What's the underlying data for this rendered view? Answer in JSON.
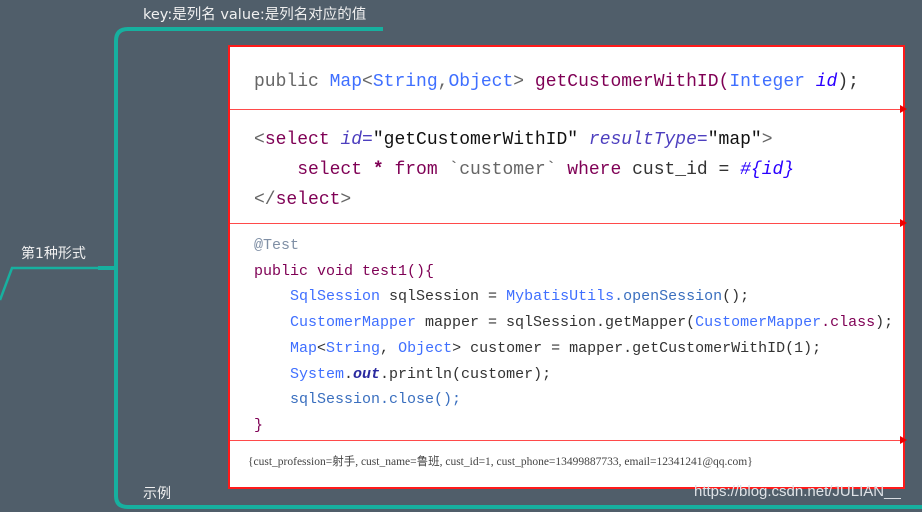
{
  "mindmap": {
    "top_label": "key:是列名  value:是列名对应的值",
    "branch_label": "第1种形式",
    "example_label": "示例",
    "line_color": "#17b09f"
  },
  "code": {
    "signature": [
      [
        {
          "t": "public ",
          "c": "g"
        },
        {
          "t": "Map",
          "c": "t"
        },
        {
          "t": "<",
          "c": "g"
        },
        {
          "t": "String",
          "c": "t"
        },
        {
          "t": ",",
          "c": "g"
        },
        {
          "t": "Object",
          "c": "t"
        },
        {
          "t": "> ",
          "c": "g"
        },
        {
          "t": "getCustomerWithID(",
          "c": "kw"
        },
        {
          "t": "Integer ",
          "c": "t"
        },
        {
          "t": "id",
          "c": "v"
        },
        {
          "t": ");",
          "c": "p"
        }
      ]
    ],
    "xml": [
      [
        {
          "t": "<",
          "c": "g"
        },
        {
          "t": "select ",
          "c": "kw"
        },
        {
          "t": "id=",
          "c": "a"
        },
        {
          "t": "\"getCustomerWithID\" ",
          "c": "s"
        },
        {
          "t": "resultType=",
          "c": "a"
        },
        {
          "t": "\"map\"",
          "c": "s"
        },
        {
          "t": ">",
          "c": "g"
        }
      ],
      [
        {
          "t": "    select ",
          "c": "kw"
        },
        {
          "t": "* ",
          "c": "k"
        },
        {
          "t": "from ",
          "c": "kw"
        },
        {
          "t": "`customer` ",
          "c": "g"
        },
        {
          "t": "where ",
          "c": "kw"
        },
        {
          "t": "cust_id = ",
          "c": "p"
        },
        {
          "t": "#{id}",
          "c": "v"
        }
      ],
      [
        {
          "t": "</",
          "c": "g"
        },
        {
          "t": "select",
          "c": "kw"
        },
        {
          "t": ">",
          "c": "g"
        }
      ]
    ],
    "test": [
      [
        {
          "t": "@Test",
          "c": "an"
        }
      ],
      [
        {
          "t": "public void ",
          "c": "kw"
        },
        {
          "t": "test1(){",
          "c": "kw"
        }
      ],
      [
        {
          "t": "    SqlSession ",
          "c": "t"
        },
        {
          "t": "sqlSession = ",
          "c": "p"
        },
        {
          "t": "MybatisUtils",
          "c": "t"
        },
        {
          "t": ".openSession",
          "c": "m"
        },
        {
          "t": "();",
          "c": "p"
        }
      ],
      [
        {
          "t": "    CustomerMapper ",
          "c": "t"
        },
        {
          "t": "mapper = sqlSession.getMapper(",
          "c": "p"
        },
        {
          "t": "CustomerMapper",
          "c": "t"
        },
        {
          "t": ".class",
          "c": "kw"
        },
        {
          "t": ");",
          "c": "p"
        }
      ],
      [
        {
          "t": "    Map",
          "c": "t"
        },
        {
          "t": "<",
          "c": "p"
        },
        {
          "t": "String",
          "c": "t"
        },
        {
          "t": ", ",
          "c": "p"
        },
        {
          "t": "Object",
          "c": "t"
        },
        {
          "t": "> customer = mapper.getCustomerWithID(1);",
          "c": "p"
        }
      ],
      [
        {
          "t": "    System",
          "c": "t"
        },
        {
          "t": ".",
          "c": "p"
        },
        {
          "t": "out",
          "c": "f"
        },
        {
          "t": ".println(customer);",
          "c": "p"
        }
      ],
      [
        {
          "t": "    sqlSession",
          "c": "m"
        },
        {
          "t": ".close();",
          "c": "m"
        }
      ],
      [
        {
          "t": "}",
          "c": "kw"
        }
      ]
    ],
    "result": "{cust_profession=射手, cust_name=鲁班, cust_id=1, cust_phone=13499887733, email=12341241@qq.com}"
  },
  "watermark": "https://blog.csdn.net/JULIAN__"
}
